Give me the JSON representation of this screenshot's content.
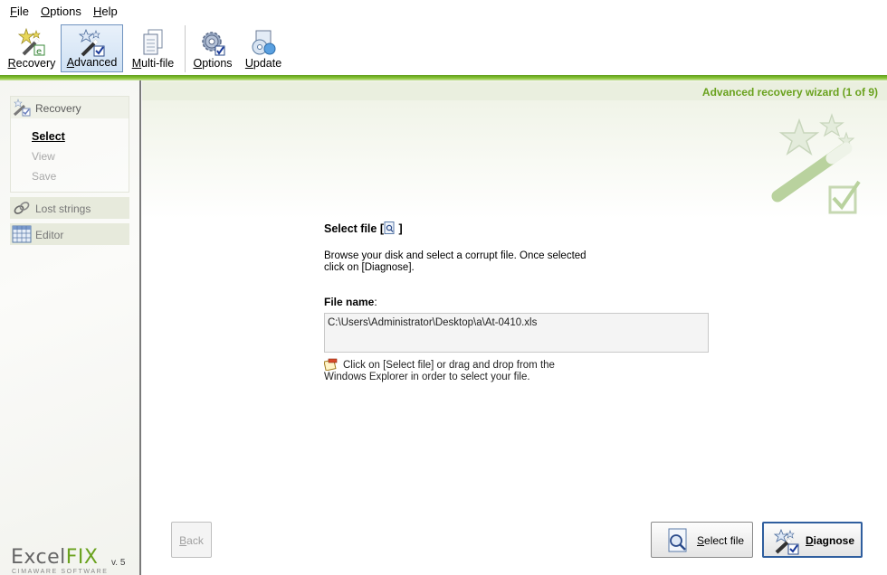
{
  "menu": {
    "file": "File",
    "options": "Options",
    "help": "Help"
  },
  "toolbar": {
    "recovery": "Recovery",
    "advanced": "Advanced",
    "multifile": "Multi-file",
    "options": "Options",
    "update": "Update"
  },
  "sidebar": {
    "recovery": "Recovery",
    "select": "Select",
    "view": "View",
    "save": "Save",
    "lost_strings": "Lost strings",
    "editor": "Editor"
  },
  "main": {
    "wizard_title": "Advanced recovery wizard (1 of 9)",
    "section_title": "Select file",
    "description": "Browse your disk and select a corrupt file. Once selected click on [Diagnose].",
    "filename_label": "File name",
    "filename_value": "C:\\Users\\Administrator\\Desktop\\a\\At-0410.xls",
    "hint": "Click on [Select file] or drag and drop from the Windows Explorer in order to select your file."
  },
  "buttons": {
    "back": "Back",
    "select_file": "Select file",
    "diagnose": "Diagnose"
  },
  "logo": {
    "excel": "Excel",
    "fix": "FIX",
    "version": "v. 5",
    "company": "CIMAWARE SOFTWARE"
  },
  "colors": {
    "accent_green": "#6aa21e",
    "toolbar_active": "#cfe1f4"
  }
}
